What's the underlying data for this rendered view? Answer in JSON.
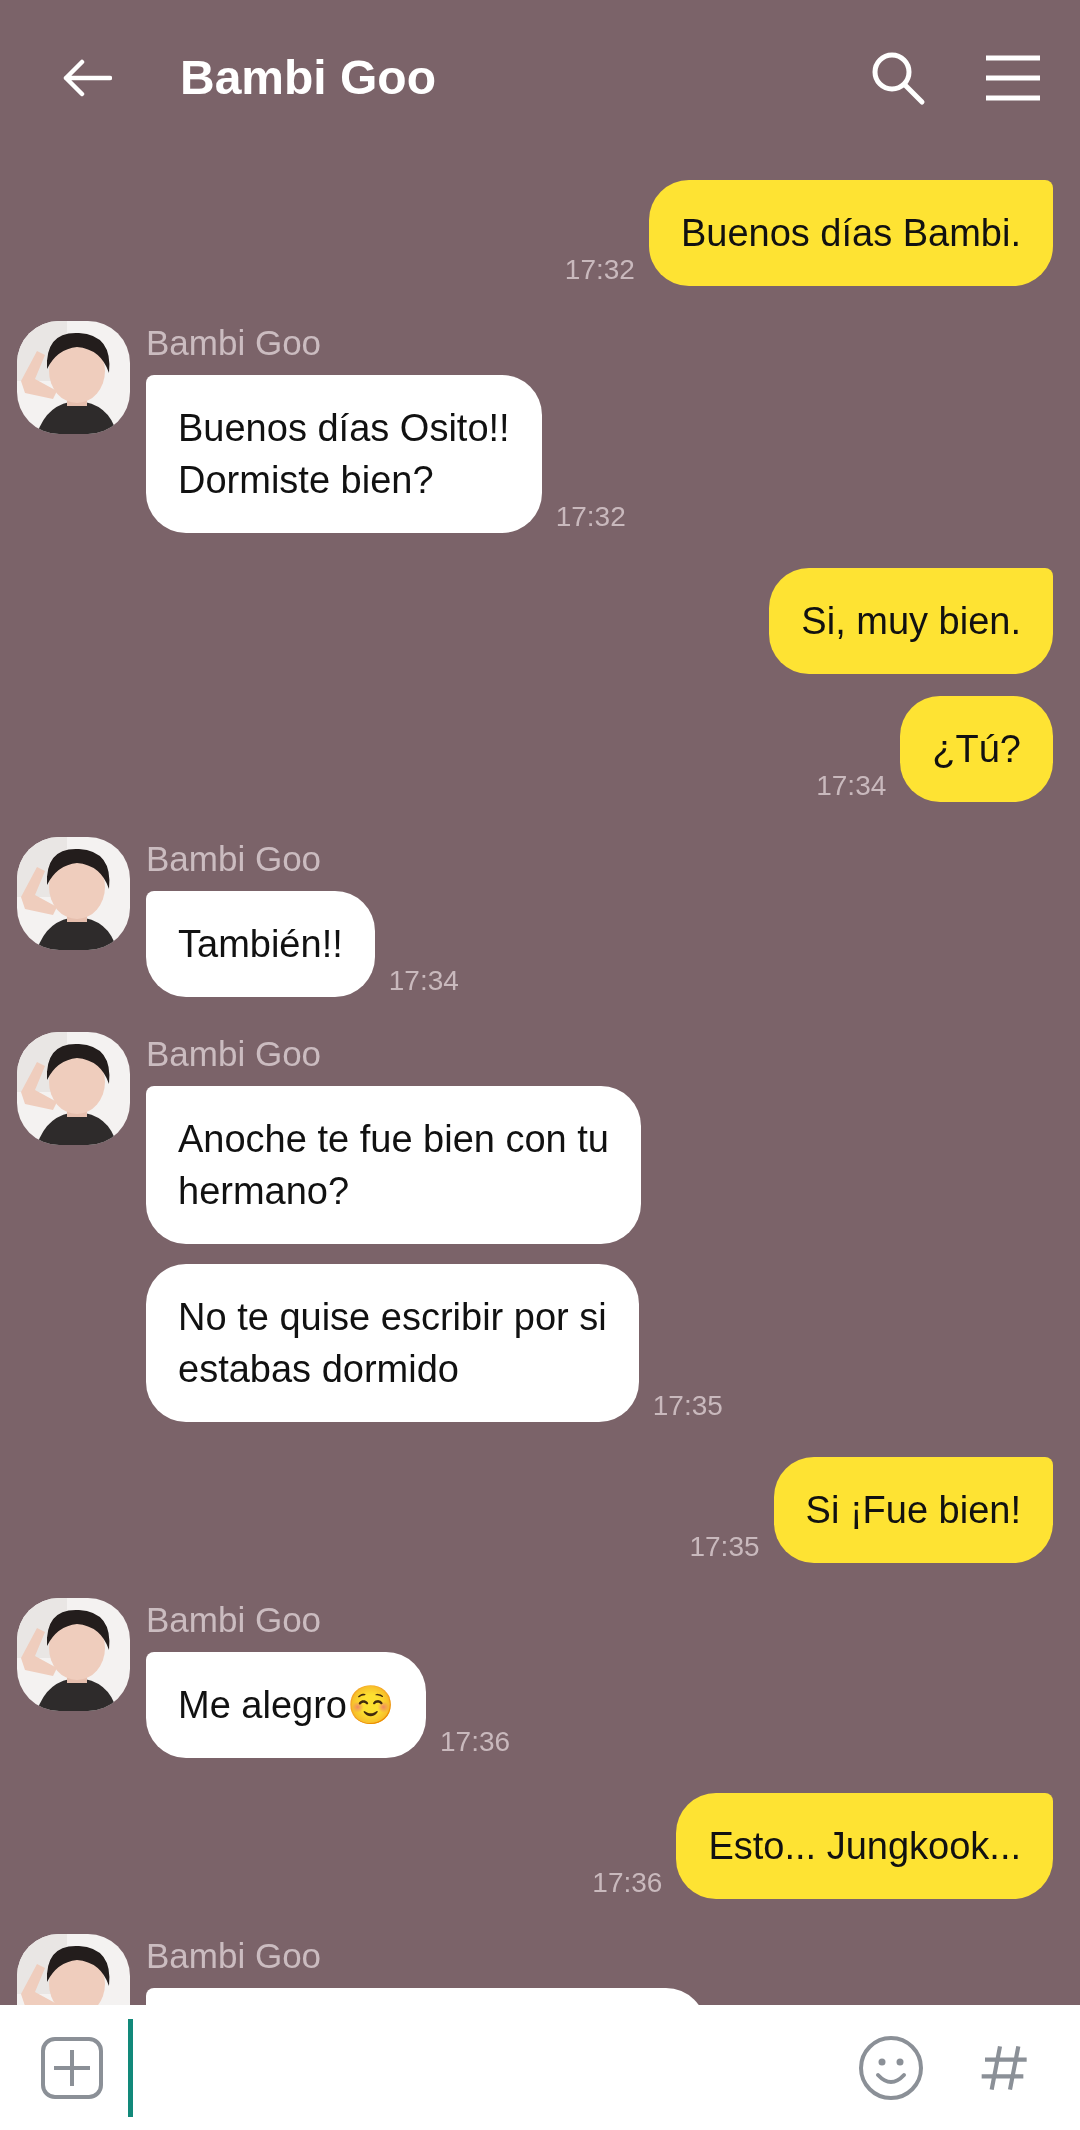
{
  "header": {
    "title": "Bambi Goo"
  },
  "messages": [
    {
      "kind": "out",
      "bubbles": [
        "Buenos días Bambi."
      ],
      "time": "17:32"
    },
    {
      "kind": "in",
      "sender": "Bambi Goo",
      "bubbles": [
        "Buenos días Osito!!\nDormiste bien?"
      ],
      "time": "17:32"
    },
    {
      "kind": "out",
      "bubbles": [
        "Si, muy bien.",
        "¿Tú?"
      ],
      "time": "17:34"
    },
    {
      "kind": "in",
      "sender": "Bambi Goo",
      "bubbles": [
        "También!!"
      ],
      "time": "17:34"
    },
    {
      "kind": "in",
      "sender": "Bambi Goo",
      "bubbles": [
        "Anoche te fue bien con tu\nhermano?",
        "No te quise escribir por si\nestabas dormido"
      ],
      "time": "17:35"
    },
    {
      "kind": "out",
      "bubbles": [
        "Si ¡Fue bien!"
      ],
      "time": "17:35"
    },
    {
      "kind": "in",
      "sender": "Bambi Goo",
      "bubbles": [
        "Me alegro☺️"
      ],
      "time": "17:36"
    },
    {
      "kind": "out",
      "bubbles": [
        "Esto... Jungkook..."
      ],
      "time": "17:36"
    },
    {
      "kind": "in",
      "sender": "Bambi Goo",
      "partial": true
    }
  ]
}
